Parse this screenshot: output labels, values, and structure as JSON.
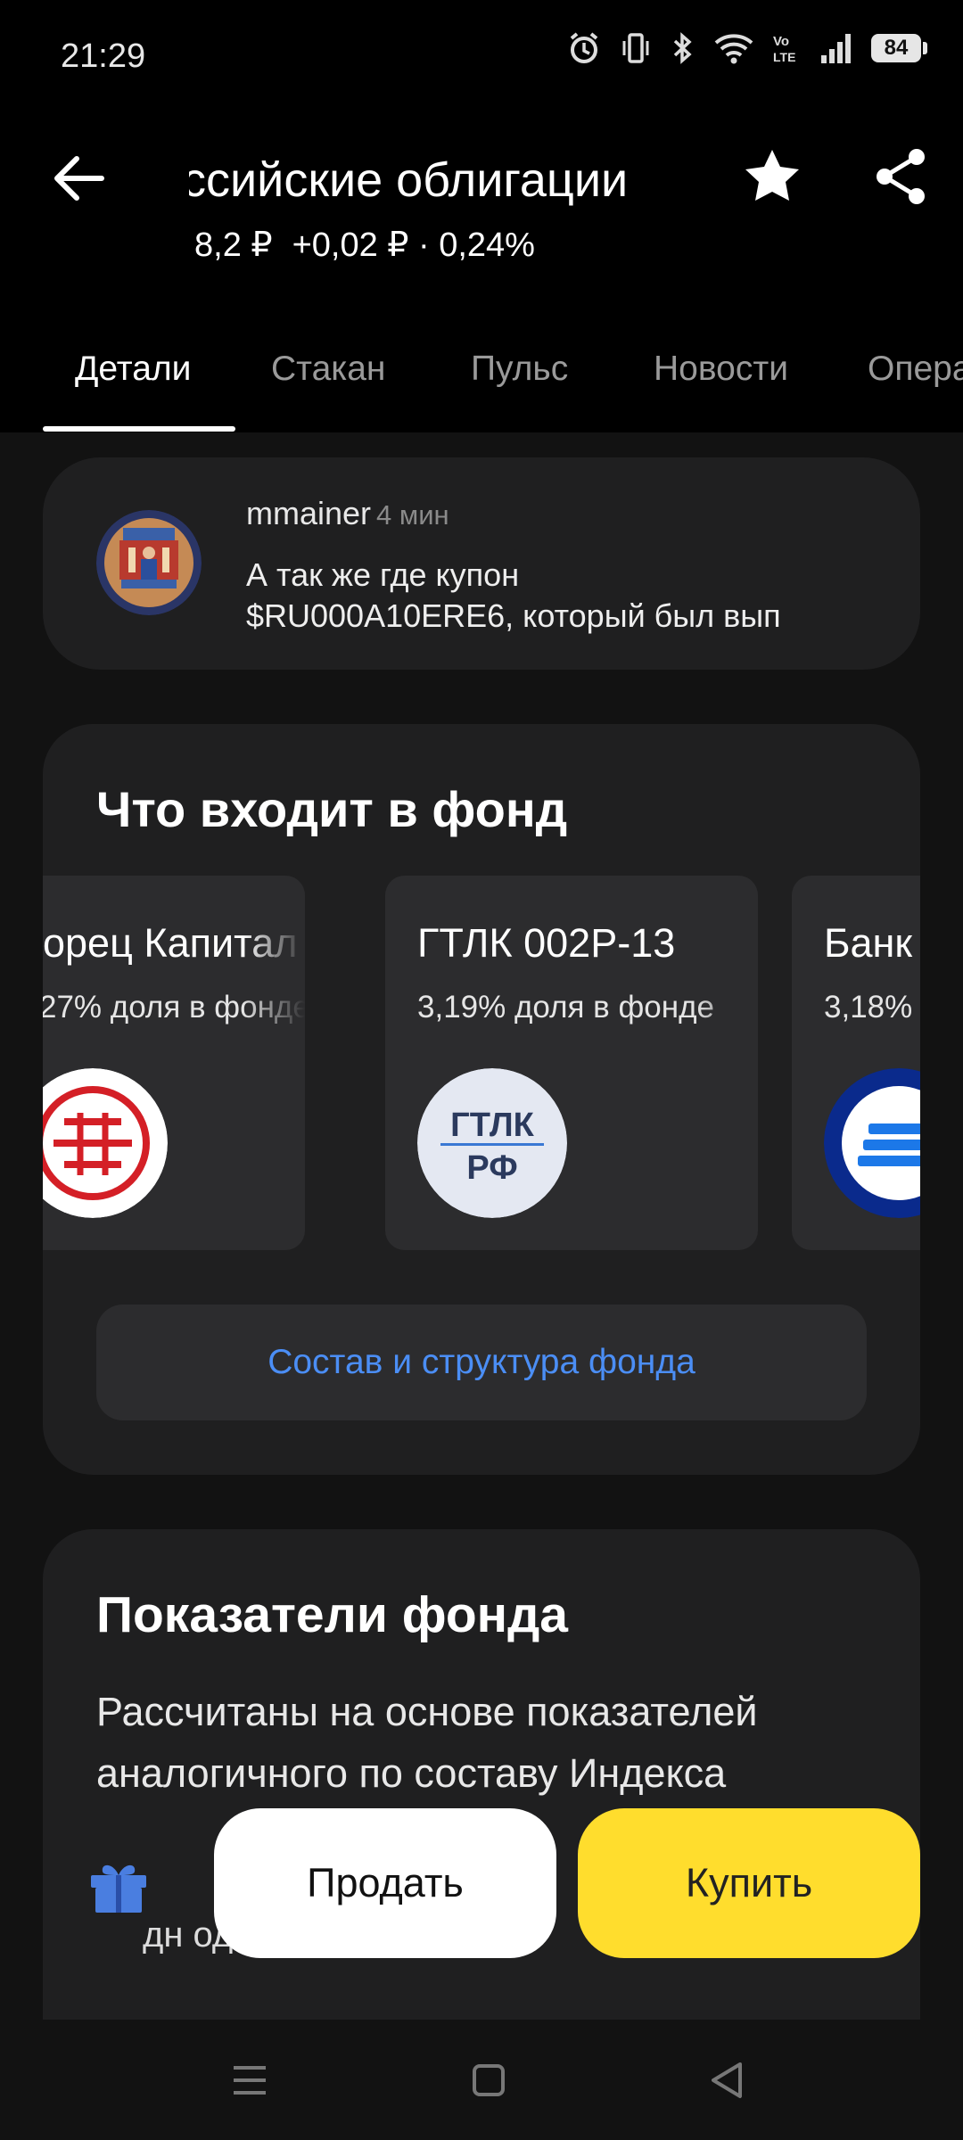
{
  "status_bar": {
    "time": "21:29",
    "battery": "84",
    "icons": [
      "alarm-icon",
      "vibrate-icon",
      "bluetooth-icon",
      "wifi-icon",
      "volte-icon",
      "signal-icon",
      "battery-icon"
    ]
  },
  "header": {
    "title": "ссийские облигации",
    "price": "8,2 ₽",
    "change": "+0,02 ₽ · 0,24%",
    "icons": [
      "back-arrow-icon",
      "star-icon",
      "share-icon"
    ]
  },
  "tabs": [
    "Детали",
    "Стакан",
    "Пульс",
    "Новости",
    "Опера"
  ],
  "pulse_post": {
    "author": "mmainer",
    "time": "4 мин",
    "text_line1": "А так же где купон",
    "text_line2": "$RU000A10ERE6, который был вып"
  },
  "fund": {
    "title": "Что входит в фонд",
    "holdings": [
      {
        "name": "орец Капитал",
        "share": "27% доля в фонде",
        "logo": "borec-logo"
      },
      {
        "name": "ГТЛК 002Р-13",
        "share": "3,19% доля в фонде",
        "logo": "gtlk-logo",
        "logo_text_1": "ГТЛК",
        "logo_text_2": "РФ"
      },
      {
        "name": "Банк",
        "share": "3,18%",
        "logo": "bank-logo"
      }
    ],
    "structure_button": "Состав и структура фонда"
  },
  "metrics": {
    "title": "Показатели фонда",
    "description": "Рассчитаны на основе показателей аналогичного по составу Индекса",
    "partial_text": "дн                    од"
  },
  "actions": {
    "sell": "Продать",
    "buy": "Купить"
  },
  "colors": {
    "accent_link": "#4b8ef5",
    "buy_button": "#ffdd2d",
    "card_bg": "#1f1f20"
  }
}
